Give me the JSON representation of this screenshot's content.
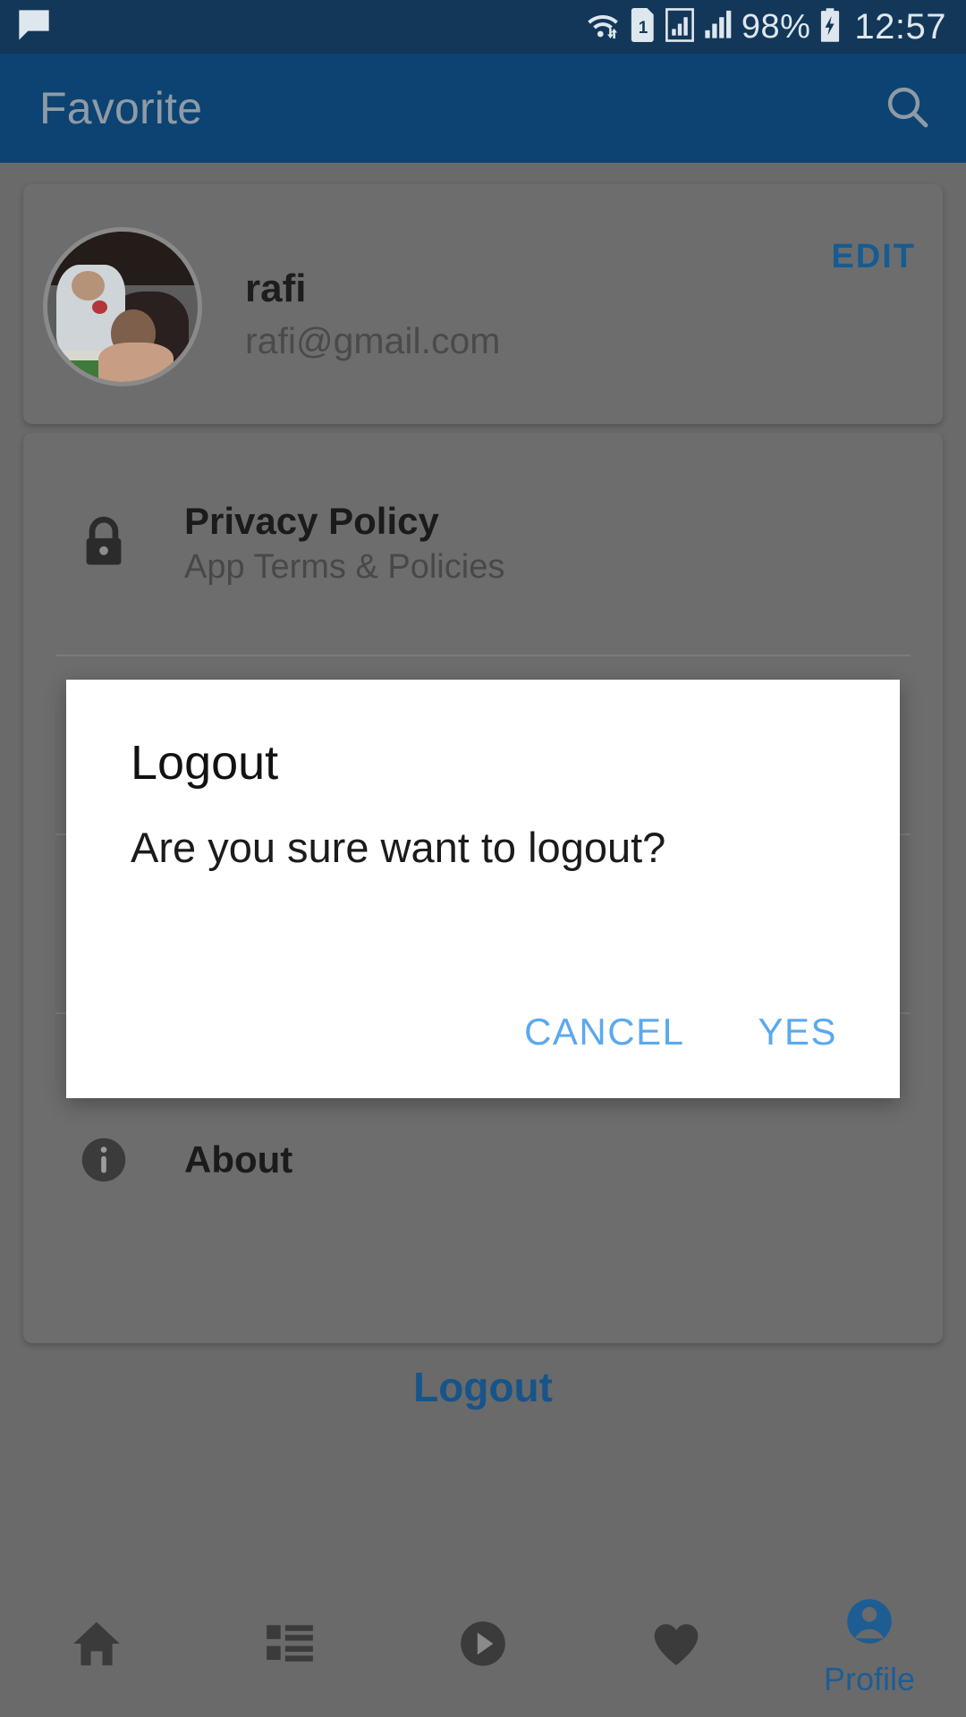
{
  "statusbar": {
    "message_icon": "chat-bubble-icon",
    "wifi_icon": "wifi-icon",
    "sim_icon": "sim-1-icon",
    "sim_label": "1",
    "signal_icon_1": "signal-bars-boxed-icon",
    "signal_icon_2": "signal-bars-icon",
    "battery_percent": "98%",
    "battery_icon": "battery-charging-icon",
    "clock": "12:57"
  },
  "appbar": {
    "title": "Favorite",
    "search_icon": "search-icon"
  },
  "profile_card": {
    "avatar_name": "avatar",
    "name": "rafi",
    "email": "rafi@gmail.com",
    "edit_label": "EDIT"
  },
  "settings_card": {
    "rows": [
      {
        "icon": "lock-icon",
        "title": "Privacy Policy",
        "subtitle": "App Terms & Policies"
      },
      {
        "icon": "info-icon",
        "title": "About",
        "subtitle": ""
      }
    ]
  },
  "logout_link": {
    "label": "Logout"
  },
  "dialog": {
    "title": "Logout",
    "message": "Are you sure want to logout?",
    "cancel_label": "CANCEL",
    "confirm_label": "YES",
    "accent_color": "#5aa9ee"
  },
  "bottomnav": {
    "items": [
      {
        "icon": "home-icon",
        "label": "",
        "active": false
      },
      {
        "icon": "list-icon",
        "label": "",
        "active": false
      },
      {
        "icon": "play-circle-icon",
        "label": "",
        "active": false
      },
      {
        "icon": "heart-icon",
        "label": "",
        "active": false
      },
      {
        "icon": "person-icon",
        "label": "Profile",
        "active": true
      }
    ],
    "active_color": "#1d5d94"
  },
  "colors": {
    "statusbar_bg": "#123759",
    "appbar_bg": "#0d4372",
    "page_bg": "#6a6a6a",
    "card_bg": "#6d6d6d",
    "dialog_bg": "#ffffff",
    "brand": "#17548a"
  }
}
